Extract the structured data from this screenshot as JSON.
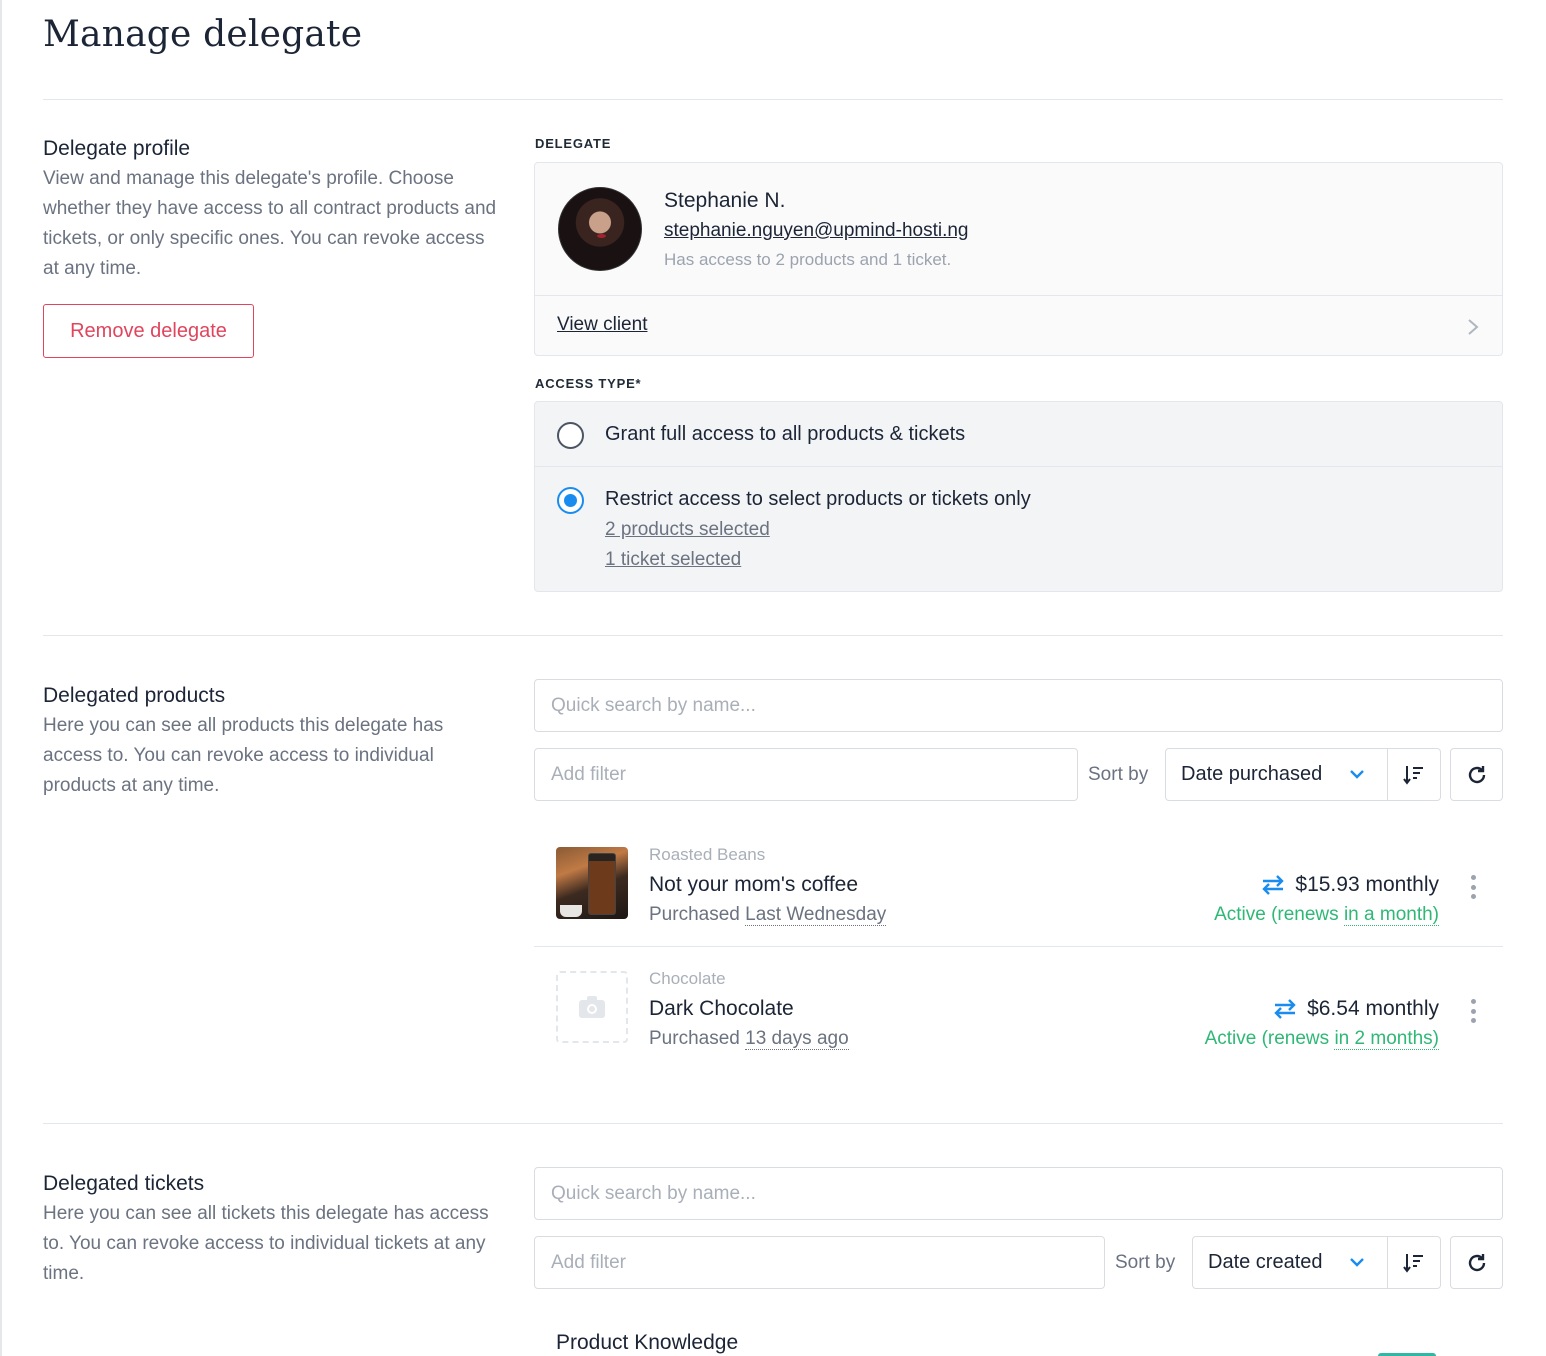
{
  "page": {
    "title": "Manage delegate"
  },
  "profile_section": {
    "title": "Delegate profile",
    "description": "View and manage this delegate's profile. Choose whether they have access to all contract products and tickets, or only specific ones. You can revoke access at any time.",
    "remove_button": "Remove delegate"
  },
  "delegate": {
    "label": "DELEGATE",
    "name": "Stephanie N.",
    "email": "stephanie.nguyen@upmind-hosti.ng",
    "access_summary": "Has access to 2 products and 1 ticket.",
    "view_client": "View client"
  },
  "access_type": {
    "label": "ACCESS TYPE*",
    "options": [
      {
        "label": "Grant full access to all products & tickets",
        "selected": false
      },
      {
        "label": "Restrict access to select products or tickets only",
        "selected": true
      }
    ],
    "products_selected": "2 products selected",
    "tickets_selected": "1 ticket selected"
  },
  "products_section": {
    "title": "Delegated products",
    "description": "Here you can see all products this delegate has access to. You can revoke access to individual products at any time.",
    "search_placeholder": "Quick search by name...",
    "filter_placeholder": "Add filter",
    "sort_label": "Sort by",
    "sort_value": "Date purchased",
    "items": [
      {
        "category": "Roasted Beans",
        "name": "Not your mom's coffee",
        "purchased_prefix": "Purchased",
        "purchased_when": "Last Wednesday",
        "price": "$15.93 monthly",
        "status_prefix": "Active (renews",
        "status_when": "in a month)",
        "thumbnail": "coffee-photo"
      },
      {
        "category": "Chocolate",
        "name": "Dark Chocolate",
        "purchased_prefix": "Purchased",
        "purchased_when": "13 days ago",
        "price": "$6.54 monthly",
        "status_prefix": "Active (renews",
        "status_when": "in 2 months)",
        "thumbnail": "camera-icon"
      }
    ]
  },
  "tickets_section": {
    "title": "Delegated tickets",
    "description": "Here you can see all tickets this delegate has access to. You can revoke access to individual tickets at any time.",
    "search_placeholder": "Quick search by name...",
    "filter_placeholder": "Add filter",
    "sort_label": "Sort by",
    "sort_value": "Date created",
    "items": [
      {
        "title": "Product Knowledge"
      }
    ]
  },
  "colors": {
    "accent_blue": "#1a8cf0",
    "danger": "#e0455d",
    "success": "#2fb875",
    "text": "#1c2536",
    "muted": "#6b7280"
  }
}
